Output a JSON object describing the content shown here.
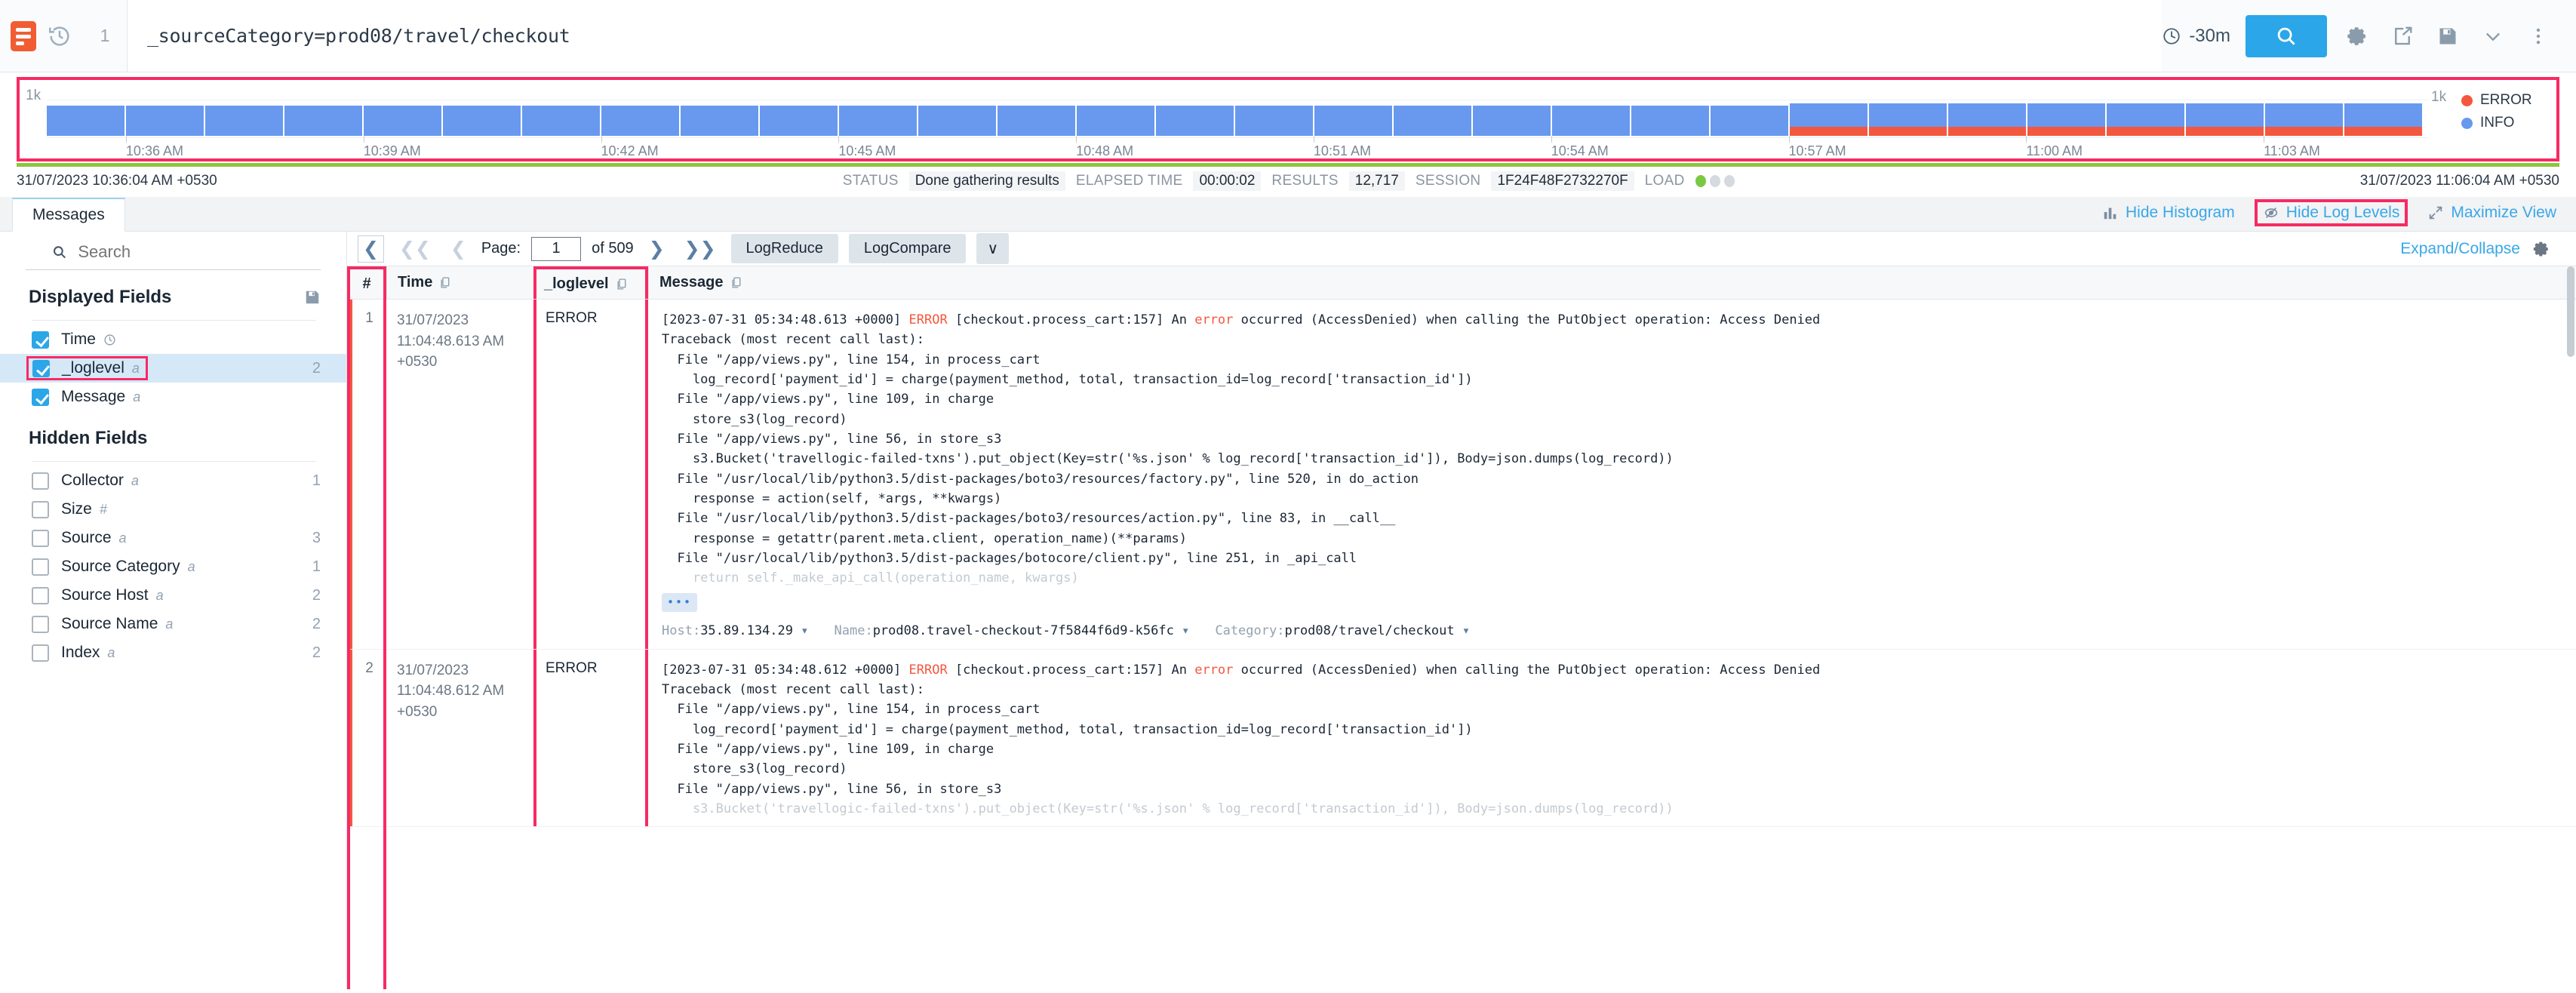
{
  "topbar": {
    "logo_name": "sumo-logo-icon",
    "history_icon": "history-clock-icon",
    "line_number": "1",
    "query": "_sourceCategory=prod08/travel/checkout",
    "time_range": "-30m",
    "search_button_label": "",
    "icons": [
      "gear-icon",
      "share-icon",
      "save-icon",
      "chevron-down-icon",
      "kebab-menu-icon"
    ]
  },
  "chart_data": {
    "type": "bar",
    "title": "",
    "xlabel": "",
    "ylabel": "",
    "ylim": [
      0,
      1000
    ],
    "ytick_label": "1k",
    "grid": true,
    "legend_position": "right",
    "stacked": true,
    "categories": [
      "10:35 AM",
      "10:36 AM",
      "10:37 AM",
      "10:38 AM",
      "10:39 AM",
      "10:40 AM",
      "10:41 AM",
      "10:42 AM",
      "10:43 AM",
      "10:44 AM",
      "10:45 AM",
      "10:46 AM",
      "10:47 AM",
      "10:48 AM",
      "10:49 AM",
      "10:50 AM",
      "10:51 AM",
      "10:52 AM",
      "10:53 AM",
      "10:54 AM",
      "10:55 AM",
      "10:56 AM",
      "10:57 AM",
      "10:58 AM",
      "10:59 AM",
      "11:00 AM",
      "11:01 AM",
      "11:02 AM",
      "11:03 AM",
      "11:04 AM"
    ],
    "tick_labels": [
      "10:36 AM",
      "10:39 AM",
      "10:42 AM",
      "10:45 AM",
      "10:48 AM",
      "10:51 AM",
      "10:54 AM",
      "10:57 AM",
      "11:00 AM",
      "11:03 AM"
    ],
    "series": [
      {
        "name": "INFO",
        "color": "#6899ef",
        "values": [
          420,
          420,
          420,
          420,
          420,
          420,
          420,
          420,
          420,
          420,
          420,
          420,
          420,
          420,
          420,
          420,
          420,
          420,
          420,
          420,
          420,
          420,
          330,
          330,
          330,
          330,
          330,
          330,
          330,
          330
        ]
      },
      {
        "name": "ERROR",
        "color": "#f4573f",
        "values": [
          0,
          0,
          0,
          0,
          0,
          0,
          0,
          0,
          0,
          0,
          0,
          0,
          0,
          0,
          0,
          0,
          0,
          0,
          0,
          0,
          0,
          0,
          120,
          120,
          120,
          120,
          120,
          120,
          120,
          120
        ]
      }
    ],
    "legend": [
      {
        "label": "ERROR",
        "color": "#f4573f"
      },
      {
        "label": "INFO",
        "color": "#6899ef"
      }
    ]
  },
  "status": {
    "start_time": "31/07/2023 10:36:04 AM +0530",
    "end_time": "31/07/2023 11:06:04 AM +0530",
    "status_key": "STATUS",
    "status_value": "Done gathering results",
    "elapsed_key": "ELAPSED TIME",
    "elapsed_value": "00:00:02",
    "results_key": "RESULTS",
    "results_value": "12,717",
    "session_key": "SESSION",
    "session_value": "1F24F48F2732270F",
    "load_key": "LOAD",
    "load_level": 1
  },
  "tabs": [
    {
      "label": "Messages",
      "active": true
    }
  ],
  "tab_actions": [
    {
      "label": "Hide Histogram",
      "icon": "bar-chart-icon",
      "highlighted": false
    },
    {
      "label": "Hide Log Levels",
      "icon": "eye-slash-icon",
      "highlighted": true
    },
    {
      "label": "Maximize View",
      "icon": "expand-arrows-icon",
      "highlighted": false
    }
  ],
  "sidebar": {
    "search_placeholder": "Search",
    "search_value": "",
    "displayed_fields": {
      "title": "Displayed Fields",
      "save_icon": "save-icon",
      "items": [
        {
          "label": "Time",
          "type_icon": "clock-icon",
          "count": "",
          "checked": true,
          "selected": false,
          "highlighted": false
        },
        {
          "label": "_loglevel",
          "type_icon": "a",
          "count": "2",
          "checked": true,
          "selected": true,
          "highlighted": true
        },
        {
          "label": "Message",
          "type_icon": "a",
          "count": "",
          "checked": true,
          "selected": false,
          "highlighted": false
        }
      ]
    },
    "hidden_fields": {
      "title": "Hidden Fields",
      "items": [
        {
          "label": "Collector",
          "type_icon": "a",
          "count": "1",
          "checked": false
        },
        {
          "label": "Size",
          "type_icon": "#",
          "count": "",
          "checked": false
        },
        {
          "label": "Source",
          "type_icon": "a",
          "count": "3",
          "checked": false
        },
        {
          "label": "Source Category",
          "type_icon": "a",
          "count": "1",
          "checked": false
        },
        {
          "label": "Source Host",
          "type_icon": "a",
          "count": "2",
          "checked": false
        },
        {
          "label": "Source Name",
          "type_icon": "a",
          "count": "2",
          "checked": false
        },
        {
          "label": "Index",
          "type_icon": "a",
          "count": "2",
          "checked": false
        }
      ]
    }
  },
  "pagination": {
    "page_label": "Page:",
    "page_value": "1",
    "of_label": "of 509",
    "logreduce_label": "LogReduce",
    "logcompare_label": "LogCompare",
    "caret_label": "∨",
    "expand_collapse_label": "Expand/Collapse",
    "gear_icon": "gear-icon"
  },
  "table": {
    "columns": [
      {
        "key": "num",
        "label": "#",
        "copy_icon": false,
        "highlighted": true
      },
      {
        "key": "time",
        "label": "Time",
        "copy_icon": true,
        "highlighted": false
      },
      {
        "key": "level",
        "label": "_loglevel",
        "copy_icon": true,
        "highlighted": true
      },
      {
        "key": "msg",
        "label": "Message",
        "copy_icon": true,
        "highlighted": false
      }
    ],
    "rows": [
      {
        "num": "1",
        "time_date": "31/07/2023",
        "time_clock": "11:04:48.613 AM +0530",
        "level": "ERROR",
        "msg_head_pre": "[2023-07-31 05:34:48.613 +0000] ",
        "msg_level": "ERROR",
        "msg_head_post": " [checkout.process_cart:157] An ",
        "msg_errword": "error",
        "msg_head_tail": " occurred (AccessDenied) when calling the PutObject operation: Access Denied",
        "msg_lines": [
          "Traceback (most recent call last):",
          "  File \"/app/views.py\", line 154, in process_cart",
          "    log_record['payment_id'] = charge(payment_method, total, transaction_id=log_record['transaction_id'])",
          "  File \"/app/views.py\", line 109, in charge",
          "    store_s3(log_record)",
          "  File \"/app/views.py\", line 56, in store_s3",
          "    s3.Bucket('travellogic-failed-txns').put_object(Key=str('%s.json' % log_record['transaction_id']), Body=json.dumps(log_record))",
          "  File \"/usr/local/lib/python3.5/dist-packages/boto3/resources/factory.py\", line 520, in do_action",
          "    response = action(self, *args, **kwargs)",
          "  File \"/usr/local/lib/python3.5/dist-packages/boto3/resources/action.py\", line 83, in __call__",
          "    response = getattr(parent.meta.client, operation_name)(**params)",
          "  File \"/usr/local/lib/python3.5/dist-packages/botocore/client.py\", line 251, in _api_call"
        ],
        "msg_faded_line": "    return self._make_api_call(operation_name, kwargs)",
        "more_label": "•••",
        "meta": [
          {
            "key": "Host:",
            "value": "35.89.134.29"
          },
          {
            "key": "Name:",
            "value": "prod08.travel-checkout-7f5844f6d9-k56fc"
          },
          {
            "key": "Category:",
            "value": "prod08/travel/checkout"
          }
        ]
      },
      {
        "num": "2",
        "time_date": "31/07/2023",
        "time_clock": "11:04:48.612 AM +0530",
        "level": "ERROR",
        "msg_head_pre": "[2023-07-31 05:34:48.612 +0000] ",
        "msg_level": "ERROR",
        "msg_head_post": " [checkout.process_cart:157] An ",
        "msg_errword": "error",
        "msg_head_tail": " occurred (AccessDenied) when calling the PutObject operation: Access Denied",
        "msg_lines": [
          "Traceback (most recent call last):",
          "  File \"/app/views.py\", line 154, in process_cart",
          "    log_record['payment_id'] = charge(payment_method, total, transaction_id=log_record['transaction_id'])",
          "  File \"/app/views.py\", line 109, in charge",
          "    store_s3(log_record)",
          "  File \"/app/views.py\", line 56, in store_s3"
        ],
        "msg_faded_line": "    s3.Bucket('travellogic-failed-txns').put_object(Key=str('%s.json' % log_record['transaction_id']), Body=json.dumps(log_record))",
        "more_label": "",
        "meta": []
      }
    ]
  },
  "colors": {
    "accent_blue": "#2ba6e8",
    "error_red": "#f4573f",
    "info_blue": "#6899ef",
    "highlight_pink": "#f72a63",
    "brand_orange": "#f15c33",
    "progress_green": "#8cc63f"
  }
}
